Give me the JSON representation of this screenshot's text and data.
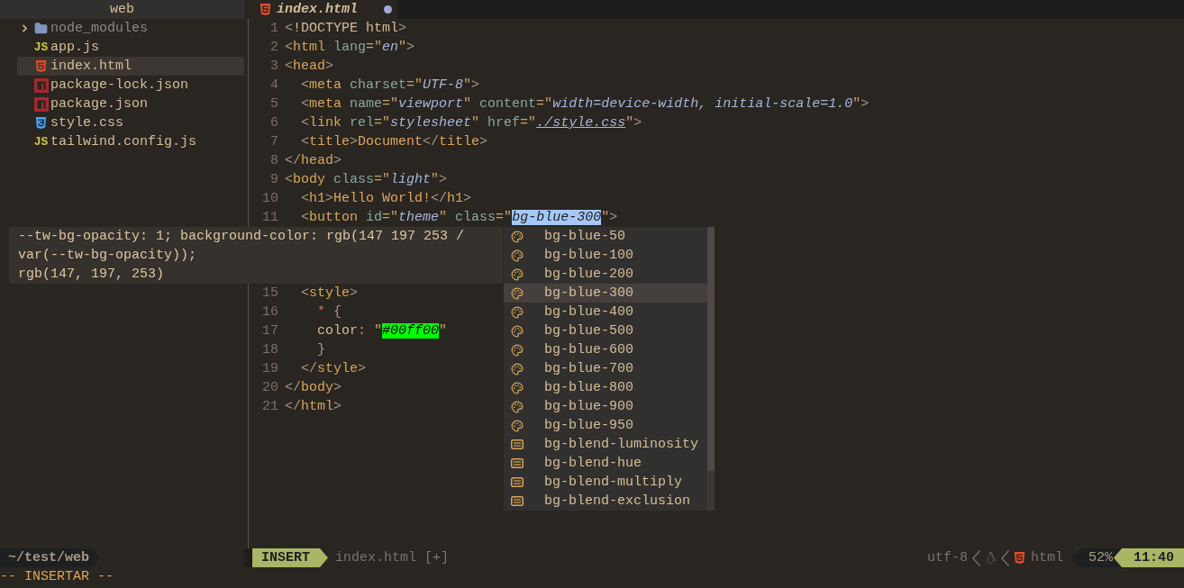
{
  "sidebar": {
    "title": "web",
    "items": [
      {
        "kind": "folder",
        "name": "node_modules",
        "expanded": false,
        "selected": false
      },
      {
        "kind": "js",
        "icon_label": "JS",
        "name": "app.js",
        "selected": false
      },
      {
        "kind": "html",
        "name": "index.html",
        "selected": true
      },
      {
        "kind": "npm",
        "name": "package-lock.json",
        "selected": false
      },
      {
        "kind": "npm",
        "name": "package.json",
        "selected": false
      },
      {
        "kind": "css",
        "name": "style.css",
        "selected": false
      },
      {
        "kind": "js",
        "icon_label": "JS",
        "name": "tailwind.config.js",
        "selected": false
      }
    ]
  },
  "tab": {
    "label": "index.html",
    "modified": true
  },
  "code_lines": [
    {
      "number": "1",
      "tokens": [
        {
          "kind": "p",
          "text": "<"
        },
        {
          "kind": "plain",
          "text": "!DOCTYPE html"
        },
        {
          "kind": "p",
          "text": ">"
        }
      ]
    },
    {
      "number": "2",
      "tokens": [
        {
          "kind": "p",
          "text": "<"
        },
        {
          "kind": "tag",
          "text": "html"
        },
        {
          "kind": "attr",
          "text": " lang"
        },
        {
          "kind": "eq",
          "text": "=\""
        },
        {
          "kind": "str",
          "text": "en"
        },
        {
          "kind": "eq",
          "text": "\""
        },
        {
          "kind": "p",
          "text": ">"
        }
      ]
    },
    {
      "number": "3",
      "tokens": [
        {
          "kind": "p",
          "text": "<"
        },
        {
          "kind": "tag",
          "text": "head"
        },
        {
          "kind": "p",
          "text": ">"
        }
      ]
    },
    {
      "number": "4",
      "tokens": [
        {
          "kind": "p",
          "text": "  <"
        },
        {
          "kind": "tag",
          "text": "meta"
        },
        {
          "kind": "attr",
          "text": " charset"
        },
        {
          "kind": "eq",
          "text": "=\""
        },
        {
          "kind": "str",
          "text": "UTF-8"
        },
        {
          "kind": "eq",
          "text": "\""
        },
        {
          "kind": "p",
          "text": ">"
        }
      ]
    },
    {
      "number": "5",
      "tokens": [
        {
          "kind": "p",
          "text": "  <"
        },
        {
          "kind": "tag",
          "text": "meta"
        },
        {
          "kind": "attr",
          "text": " name"
        },
        {
          "kind": "eq",
          "text": "=\""
        },
        {
          "kind": "str",
          "text": "viewport"
        },
        {
          "kind": "eq",
          "text": "\""
        },
        {
          "kind": "attr",
          "text": " content"
        },
        {
          "kind": "eq",
          "text": "=\""
        },
        {
          "kind": "str",
          "text": "width=device-width, initial-scale=1.0"
        },
        {
          "kind": "eq",
          "text": "\""
        },
        {
          "kind": "p",
          "text": ">"
        }
      ]
    },
    {
      "number": "6",
      "tokens": [
        {
          "kind": "p",
          "text": "  <"
        },
        {
          "kind": "tag",
          "text": "link"
        },
        {
          "kind": "attr",
          "text": " rel"
        },
        {
          "kind": "eq",
          "text": "=\""
        },
        {
          "kind": "str",
          "text": "stylesheet"
        },
        {
          "kind": "eq",
          "text": "\""
        },
        {
          "kind": "attr",
          "text": " href"
        },
        {
          "kind": "eq",
          "text": "=\""
        },
        {
          "kind": "link",
          "text": "./style.css"
        },
        {
          "kind": "eq",
          "text": "\""
        },
        {
          "kind": "p",
          "text": ">"
        }
      ]
    },
    {
      "number": "7",
      "tokens": [
        {
          "kind": "p",
          "text": "  <"
        },
        {
          "kind": "tag",
          "text": "title"
        },
        {
          "kind": "p",
          "text": ">"
        },
        {
          "kind": "text",
          "text": "Document"
        },
        {
          "kind": "p",
          "text": "</"
        },
        {
          "kind": "tag",
          "text": "title"
        },
        {
          "kind": "p",
          "text": ">"
        }
      ]
    },
    {
      "number": "8",
      "tokens": [
        {
          "kind": "p",
          "text": "</"
        },
        {
          "kind": "tag",
          "text": "head"
        },
        {
          "kind": "p",
          "text": ">"
        }
      ]
    },
    {
      "number": "9",
      "tokens": [
        {
          "kind": "p",
          "text": "<"
        },
        {
          "kind": "tag",
          "text": "body"
        },
        {
          "kind": "attr",
          "text": " class"
        },
        {
          "kind": "eq",
          "text": "=\""
        },
        {
          "kind": "str",
          "text": "light"
        },
        {
          "kind": "eq",
          "text": "\""
        },
        {
          "kind": "p",
          "text": ">"
        }
      ]
    },
    {
      "number": "10",
      "tokens": [
        {
          "kind": "p",
          "text": "  <"
        },
        {
          "kind": "tag",
          "text": "h1"
        },
        {
          "kind": "p",
          "text": ">"
        },
        {
          "kind": "text",
          "text": "Hello World!"
        },
        {
          "kind": "p",
          "text": "</"
        },
        {
          "kind": "tag",
          "text": "h1"
        },
        {
          "kind": "p",
          "text": ">"
        }
      ]
    },
    {
      "number": "11",
      "tokens": [
        {
          "kind": "p",
          "text": "  <"
        },
        {
          "kind": "tag",
          "text": "button"
        },
        {
          "kind": "attr",
          "text": " id"
        },
        {
          "kind": "eq",
          "text": "=\""
        },
        {
          "kind": "str",
          "text": "theme"
        },
        {
          "kind": "eq",
          "text": "\""
        },
        {
          "kind": "attr",
          "text": " class"
        },
        {
          "kind": "eq",
          "text": "=\""
        },
        {
          "kind": "sel",
          "text": "bg-blue-300"
        },
        {
          "kind": "eq",
          "text": "\""
        },
        {
          "kind": "p",
          "text": ">"
        }
      ]
    },
    {
      "number": "15",
      "tokens": [
        {
          "kind": "p",
          "text": "  <"
        },
        {
          "kind": "tag",
          "text": "style"
        },
        {
          "kind": "p",
          "text": ">"
        }
      ]
    },
    {
      "number": "16",
      "tokens": [
        {
          "kind": "star",
          "text": "    *"
        },
        {
          "kind": "p",
          "text": " {"
        }
      ]
    },
    {
      "number": "17",
      "tokens": [
        {
          "kind": "prop",
          "text": "    color"
        },
        {
          "kind": "op",
          "text": ":"
        },
        {
          "kind": "eq",
          "text": " \""
        },
        {
          "kind": "swatch",
          "text": "#00ff00",
          "color": "#00ff00"
        },
        {
          "kind": "eq",
          "text": "\""
        }
      ]
    },
    {
      "number": "18",
      "tokens": [
        {
          "kind": "p",
          "text": "    }"
        }
      ]
    },
    {
      "number": "19",
      "tokens": [
        {
          "kind": "p",
          "text": "  </"
        },
        {
          "kind": "tag",
          "text": "style"
        },
        {
          "kind": "p",
          "text": ">"
        }
      ]
    },
    {
      "number": "20",
      "tokens": [
        {
          "kind": "p",
          "text": "</"
        },
        {
          "kind": "tag",
          "text": "body"
        },
        {
          "kind": "p",
          "text": ">"
        }
      ]
    },
    {
      "number": "21",
      "tokens": [
        {
          "kind": "p",
          "text": "</"
        },
        {
          "kind": "tag",
          "text": "html"
        },
        {
          "kind": "p",
          "text": ">"
        }
      ]
    }
  ],
  "hover_doc": [
    "--tw-bg-opacity: 1; background-color: rgb(147 197 253 /",
    "var(--tw-bg-opacity));",
    "rgb(147, 197, 253)"
  ],
  "completion": [
    {
      "kind": "color",
      "label": "bg-blue-50",
      "selected": false
    },
    {
      "kind": "color",
      "label": "bg-blue-100",
      "selected": false
    },
    {
      "kind": "color",
      "label": "bg-blue-200",
      "selected": false
    },
    {
      "kind": "color",
      "label": "bg-blue-300",
      "selected": true
    },
    {
      "kind": "color",
      "label": "bg-blue-400",
      "selected": false
    },
    {
      "kind": "color",
      "label": "bg-blue-500",
      "selected": false
    },
    {
      "kind": "color",
      "label": "bg-blue-600",
      "selected": false
    },
    {
      "kind": "color",
      "label": "bg-blue-700",
      "selected": false
    },
    {
      "kind": "color",
      "label": "bg-blue-800",
      "selected": false
    },
    {
      "kind": "color",
      "label": "bg-blue-900",
      "selected": false
    },
    {
      "kind": "color",
      "label": "bg-blue-950",
      "selected": false
    },
    {
      "kind": "text",
      "label": "bg-blend-luminosity",
      "selected": false
    },
    {
      "kind": "text",
      "label": "bg-blend-hue",
      "selected": false
    },
    {
      "kind": "text",
      "label": "bg-blend-multiply",
      "selected": false
    },
    {
      "kind": "text",
      "label": "bg-blend-exclusion",
      "selected": false
    }
  ],
  "status_bar": {
    "cwd": "~/test/web",
    "mode": "INSERT",
    "file": "index.html [+]",
    "encoding": "utf-8",
    "filetype": "html",
    "percent": "52%",
    "position": "11:40"
  },
  "command_line": "-- INSERTAR --"
}
